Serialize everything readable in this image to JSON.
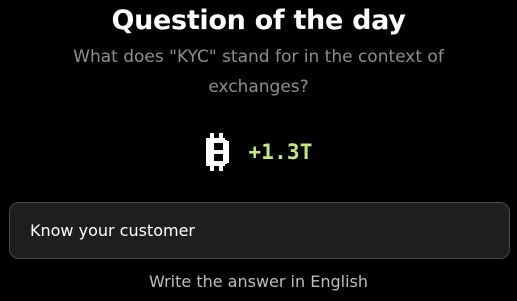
{
  "header": {
    "title": "Question of the day",
    "question": "What does \"KYC\" stand for in the context of exchanges?"
  },
  "reward": {
    "icon": "coin-icon",
    "amount": "+1.3T",
    "amount_color": "#c5e97f"
  },
  "answer": {
    "value": "Know your customer"
  },
  "footer": {
    "hint": "Write the answer in English"
  }
}
